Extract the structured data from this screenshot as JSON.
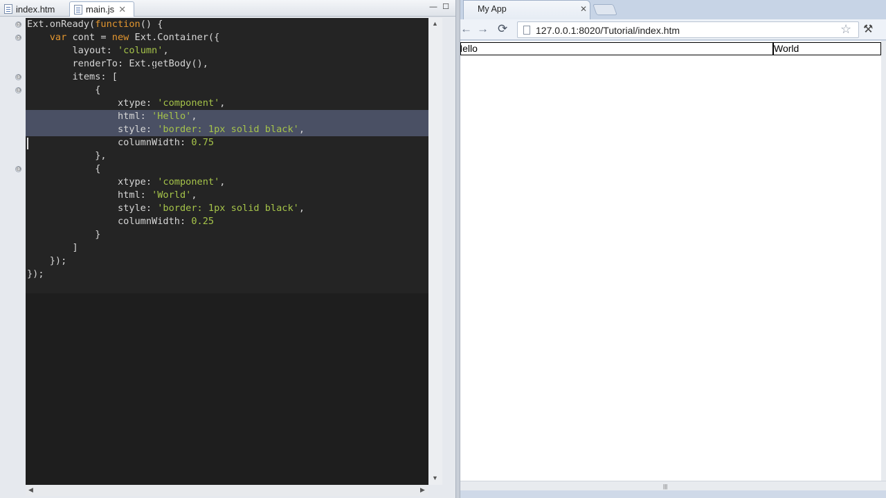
{
  "editor": {
    "tabs": [
      {
        "label": "index.htm",
        "icon": "html-file-icon"
      },
      {
        "label": "main.js",
        "icon": "js-file-icon",
        "close": "✕",
        "active": true
      }
    ],
    "window_buttons": {
      "minimize": "—",
      "maximize": "☐"
    },
    "code_lines": [
      "Ext.onReady(function() {",
      "    var cont = new Ext.Container({",
      "        layout: 'column',",
      "        renderTo: Ext.getBody(),",
      "        items: [",
      "            {",
      "                xtype: 'component',",
      "                html: 'Hello',",
      "                style: 'border: 1px solid black',",
      "                columnWidth: 0.75",
      "            },",
      "            {",
      "                xtype: 'component',",
      "                html: 'World',",
      "                style: 'border: 1px solid black',",
      "                columnWidth: 0.25",
      "            }",
      "        ]",
      "    });",
      "});"
    ],
    "highlighted_lines": [
      7,
      8
    ],
    "folded_markers": [
      "⊖",
      "⊖",
      "⊖",
      "⊖",
      "⊖"
    ]
  },
  "browser": {
    "tab_title": "My App",
    "tab_close": "✕",
    "url": "127.0.0.1:8020/Tutorial/index.htm",
    "nav": {
      "back": "←",
      "forward": "→",
      "reload": "⟳"
    },
    "star": "☆",
    "wrench": "🔧",
    "content": {
      "column_1": "Hello",
      "column_2": "World"
    }
  }
}
